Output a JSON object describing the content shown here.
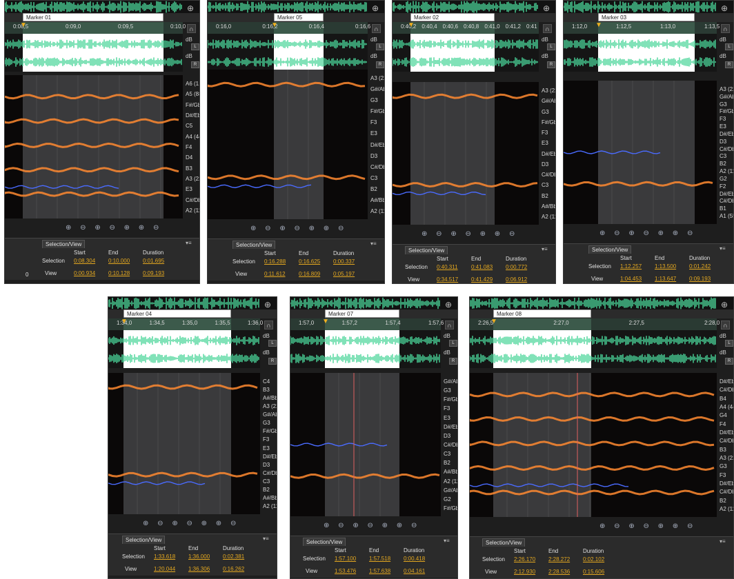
{
  "colors": {
    "background": "#1e1e1e",
    "selection_value": "#e4a820",
    "waveform": "#4bd69a",
    "pitch_line": "#4a6bff",
    "harmonic": "#ff8a30",
    "playhead": "#f0b020"
  },
  "icons": {
    "zoom": "magnifier-icon",
    "snap": "magnet-icon"
  },
  "sv_headers": {
    "start": "Start",
    "end": "End",
    "duration": "Duration",
    "row_selection": "Selection",
    "row_view": "View"
  },
  "panels": [
    {
      "marker": "Marker 01",
      "ticks": [
        "0:08,5",
        "0:09,0",
        "0:09,5",
        "0:10,0"
      ],
      "notes": [
        "A6 (1,8k)",
        "A5 (880)",
        "F#/Gb5",
        "D#/Eb5",
        "C5",
        "A4 (440)",
        "F4",
        "D4",
        "B3",
        "A3 (220)",
        "E3",
        "C#/Db3",
        "A2 (110)"
      ],
      "tab": "Selection/View",
      "selection": {
        "start": "0:08.304",
        "end": "0:10.000",
        "duration": "0:01.695"
      },
      "view": {
        "start": "0:00.934",
        "end": "0:10.128",
        "duration": "0:09.193"
      },
      "extra": "0"
    },
    {
      "marker": "Marker 05",
      "ticks": [
        "0:16,0",
        "0:16,2",
        "0:16,4",
        "0:16,6"
      ],
      "notes": [
        "A3 (220)",
        "G#/Ab3",
        "G3",
        "F#/Gb3",
        "F3",
        "E3",
        "D#/Eb3",
        "D3",
        "C#/Db3",
        "C3",
        "B2",
        "A#/Bb2",
        "A2 (110)"
      ],
      "tab": "Selection/View",
      "selection": {
        "start": "0:16.288",
        "end": "0:16.625",
        "duration": "0:00.337"
      },
      "view": {
        "start": "0:11.612",
        "end": "0:16.809",
        "duration": "0:05.197"
      }
    },
    {
      "marker": "Marker 02",
      "ticks": [
        "0:40,2",
        "0:40,4",
        "0:40,6",
        "0:40,8",
        "0:41,0",
        "0:41,2",
        "0:41"
      ],
      "notes": [
        "A3 (220)",
        "G#/Ab3",
        "G3",
        "F#/Gb3",
        "F3",
        "E3",
        "D#/Eb3",
        "D3",
        "C#/Db3",
        "C3",
        "B2",
        "A#/Bb2",
        "A2 (110)"
      ],
      "tab": "Selection/View",
      "selection": {
        "start": "0:40.311",
        "end": "0:41.083",
        "duration": "0:00.772"
      },
      "view": {
        "start": "0:34.517",
        "end": "0:41.429",
        "duration": "0:06.912"
      }
    },
    {
      "marker": "Marker 03",
      "ticks": [
        "1:12,0",
        "1:12,5",
        "1:13,0",
        "1:13,5"
      ],
      "notes": [
        "A3 (220)",
        "G#/Ab3",
        "G3",
        "F#/Gb3",
        "F3",
        "E3",
        "D#/Eb3",
        "D3",
        "C#/Db3",
        "C3",
        "B2",
        "A2 (110)",
        "G2",
        "F2",
        "D#/Eb2",
        "C#/Db2",
        "B1",
        "A1 (55)"
      ],
      "tab": "Selection/View",
      "selection": {
        "start": "1:12.257",
        "end": "1:13.500",
        "duration": "0:01.242"
      },
      "view": {
        "start": "1:04.453",
        "end": "1:13.647",
        "duration": "0:09.193"
      }
    },
    {
      "marker": "Marker 04",
      "ticks": [
        "1:34,0",
        "1:34,5",
        "1:35,0",
        "1:35,5",
        "1:36,0"
      ],
      "notes": [
        "C4",
        "B3",
        "A#/Bb3",
        "A3 (220)",
        "G#/Ab3",
        "G3",
        "F#/Gb3",
        "F3",
        "E3",
        "D#/Eb3",
        "D3",
        "C#/Db3",
        "C3",
        "B2",
        "A#/Bb2",
        "A2 (110)"
      ],
      "tab": "Selection/View",
      "selection": {
        "start": "1:33.618",
        "end": "1:36.000",
        "duration": "0:02.381"
      },
      "view": {
        "start": "1:20.044",
        "end": "1:36.306",
        "duration": "0:16.262"
      }
    },
    {
      "marker": "Marker 07",
      "ticks": [
        "1:57,0",
        "1:57,2",
        "1:57,4",
        "1:57,6"
      ],
      "notes": [
        "G#/Ab3",
        "G3",
        "F#/Gb3",
        "F3",
        "E3",
        "D#/Eb3",
        "D3",
        "C#/Db3",
        "C3",
        "B2",
        "A#/Bb2",
        "A2 (110)",
        "G#/Ab2",
        "G2",
        "F#/Gb2"
      ],
      "tab": "Selection/View",
      "selection": {
        "start": "1:57.100",
        "end": "1:57.518",
        "duration": "0:00.418"
      },
      "view": {
        "start": "1:53.476",
        "end": "1:57.638",
        "duration": "0:04.161"
      }
    },
    {
      "marker": "Marker 08",
      "ticks": [
        "2:26,5",
        "2:27,0",
        "2:27,5",
        "2:28,0"
      ],
      "notes": [
        "D#/Eb5",
        "C#/Db5",
        "B4",
        "A4 (440)",
        "G4",
        "F4",
        "D#/Eb4",
        "C#/Db4",
        "B3",
        "A3 (220)",
        "G3",
        "F3",
        "D#/Eb3",
        "C#/Db3",
        "B2",
        "A2 (110)"
      ],
      "tab": "Selection/View",
      "selection": {
        "start": "2:26.170",
        "end": "2:28.272",
        "duration": "0:02.102"
      },
      "view": {
        "start": "2:12.930",
        "end": "2:28.536",
        "duration": "0:15.606"
      }
    }
  ],
  "db_label": "dB",
  "channel_left": "L",
  "channel_right": "R",
  "zoom_icons": "⊕ ⊖ ⊕ ⊖ ⊕ ⊕ ⊖"
}
